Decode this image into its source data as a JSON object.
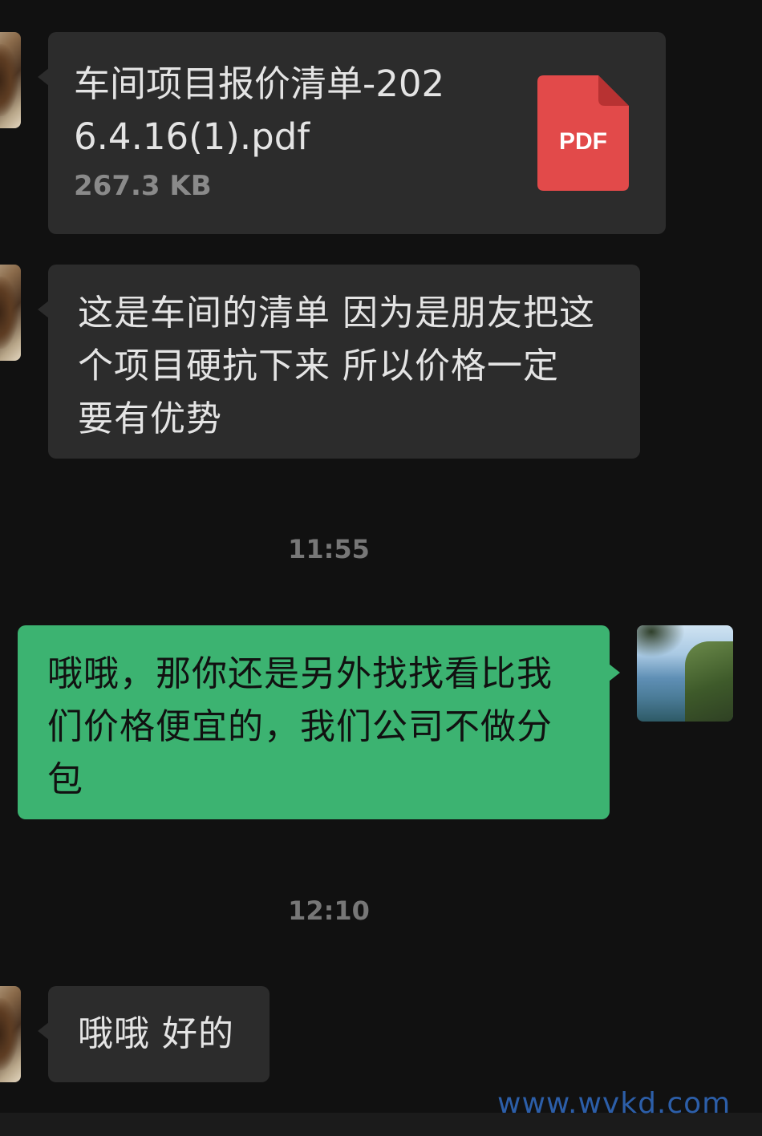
{
  "messages": {
    "file_message": {
      "file_name": "车间项目报价清单-2026.4.16(1).pdf",
      "file_size": "267.3 KB",
      "file_icon": "pdf-file-icon",
      "file_icon_label": "PDF",
      "file_icon_color": "#e24a4a"
    },
    "text_message_1": {
      "lines": [
        "这是车间的清单 因为是朋友把这",
        "个项目硬抗下来  所以价格一定",
        "要有优势"
      ]
    },
    "timestamp_1": "11:55",
    "text_message_2": {
      "lines": [
        "哦哦，那你还是另外找找看比我",
        "们价格便宜的，我们公司不做分",
        "包"
      ]
    },
    "timestamp_2": "12:10",
    "text_message_3": {
      "lines": [
        "哦哦 好的"
      ]
    }
  },
  "watermark": "www.wvkd.com",
  "colors": {
    "background": "#111111",
    "incoming_bubble": "#2c2c2c",
    "outgoing_bubble": "#3cb371",
    "text": "#e4e4e4",
    "timestamp": "#777777",
    "watermark": "#2c5ea8"
  }
}
